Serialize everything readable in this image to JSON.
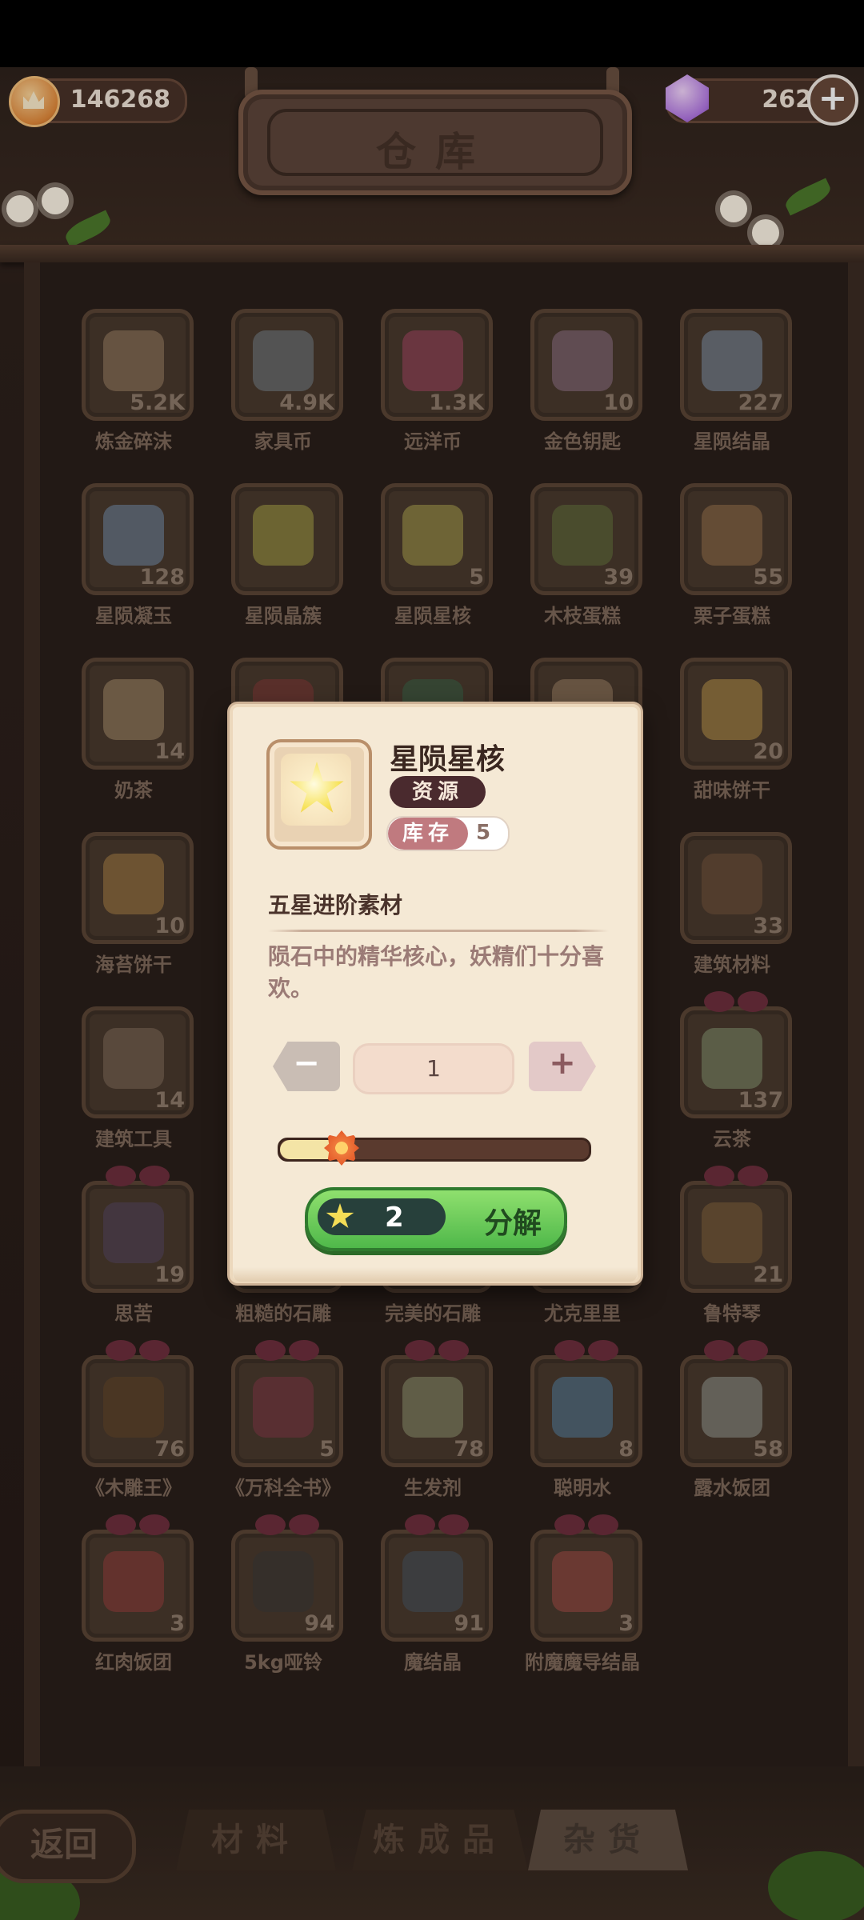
{
  "header": {
    "title": "仓库",
    "coins": "146268",
    "gems": "262",
    "coin_icon": "crown-coin-icon",
    "gem_icon": "gem-icon"
  },
  "inventory": [
    {
      "name": "炼金碎沫",
      "count": "5.2K",
      "color": "#a88b6d"
    },
    {
      "name": "家具币",
      "count": "4.9K",
      "color": "#7d8a95"
    },
    {
      "name": "远洋币",
      "count": "1.3K",
      "color": "#b14a6b"
    },
    {
      "name": "金色钥匙",
      "count": "10",
      "color": "#9a7a92"
    },
    {
      "name": "星陨结晶",
      "count": "227",
      "color": "#8aa0bb"
    },
    {
      "name": "星陨凝玉",
      "count": "128",
      "color": "#7a98b8"
    },
    {
      "name": "星陨晶簇",
      "count": "",
      "color": "#b4b04c"
    },
    {
      "name": "星陨星核",
      "count": "5",
      "color": "#b9b055"
    },
    {
      "name": "木枝蛋糕",
      "count": "39",
      "color": "#6a7a42"
    },
    {
      "name": "栗子蛋糕",
      "count": "55",
      "color": "#a47a52"
    },
    {
      "name": "奶茶",
      "count": "14",
      "color": "#b39774"
    },
    {
      "name": "",
      "count": "",
      "color": "#8a3a3a"
    },
    {
      "name": "",
      "count": "",
      "color": "#3a6a4a"
    },
    {
      "name": "",
      "count": "",
      "color": "#a88b6d"
    },
    {
      "name": "甜味饼干",
      "count": "20",
      "color": "#c8a050"
    },
    {
      "name": "海苔饼干",
      "count": "10",
      "color": "#b68a4a"
    },
    {
      "name": "",
      "count": "",
      "color": ""
    },
    {
      "name": "",
      "count": "",
      "color": ""
    },
    {
      "name": "",
      "count": "",
      "color": ""
    },
    {
      "name": "建筑材料",
      "count": "33",
      "color": "#7a5a42"
    },
    {
      "name": "建筑工具",
      "count": "14",
      "color": "#8a7462"
    },
    {
      "name": "",
      "count": "",
      "color": ""
    },
    {
      "name": "",
      "count": "",
      "color": ""
    },
    {
      "name": "",
      "count": "",
      "color": ""
    },
    {
      "name": "云茶",
      "count": "137",
      "color": "#8ea07a",
      "bow": true
    },
    {
      "name": "思苦",
      "count": "19",
      "color": "#5a4a6a",
      "bow": true
    },
    {
      "name": "粗糙的石雕",
      "count": "",
      "color": "",
      "bow": true
    },
    {
      "name": "完美的石雕",
      "count": "",
      "color": "",
      "bow": true
    },
    {
      "name": "尤克里里",
      "count": "",
      "color": "",
      "bow": true
    },
    {
      "name": "鲁特琴",
      "count": "21",
      "color": "#8a6a42",
      "bow": true
    },
    {
      "name": "《木雕王》",
      "count": "76",
      "color": "#6a4a2a",
      "bow": true
    },
    {
      "name": "《万科全书》",
      "count": "5",
      "color": "#8a3a4a",
      "bow": true
    },
    {
      "name": "生发剂",
      "count": "78",
      "color": "#9aa07a",
      "bow": true
    },
    {
      "name": "聪明水",
      "count": "8",
      "color": "#5a8ab0",
      "bow": true
    },
    {
      "name": "露水饭团",
      "count": "58",
      "color": "#a0a8a0",
      "bow": true
    },
    {
      "name": "红肉饭团",
      "count": "3",
      "color": "#a04040",
      "bow": true
    },
    {
      "name": "5kg哑铃",
      "count": "94",
      "color": "#3a3a3a",
      "bow": true
    },
    {
      "name": "魔结晶",
      "count": "91",
      "color": "#4a5a6a",
      "bow": true
    },
    {
      "name": "附魔魔导结晶",
      "count": "3",
      "color": "#b0504a",
      "bow": true
    }
  ],
  "popup": {
    "name": "星陨星核",
    "type": "资源",
    "stock_label": "库存",
    "stock_value": "5",
    "subtitle": "五星进阶素材",
    "description": "陨石中的精华核心，妖精们十分喜欢。",
    "quantity": "1",
    "slider_fraction": 0.2,
    "cost": "2",
    "action": "分解"
  },
  "tabs": [
    {
      "label": "材料",
      "active": false
    },
    {
      "label": "炼成品",
      "active": false
    },
    {
      "label": "杂货",
      "active": true
    }
  ],
  "back_label": "返回"
}
